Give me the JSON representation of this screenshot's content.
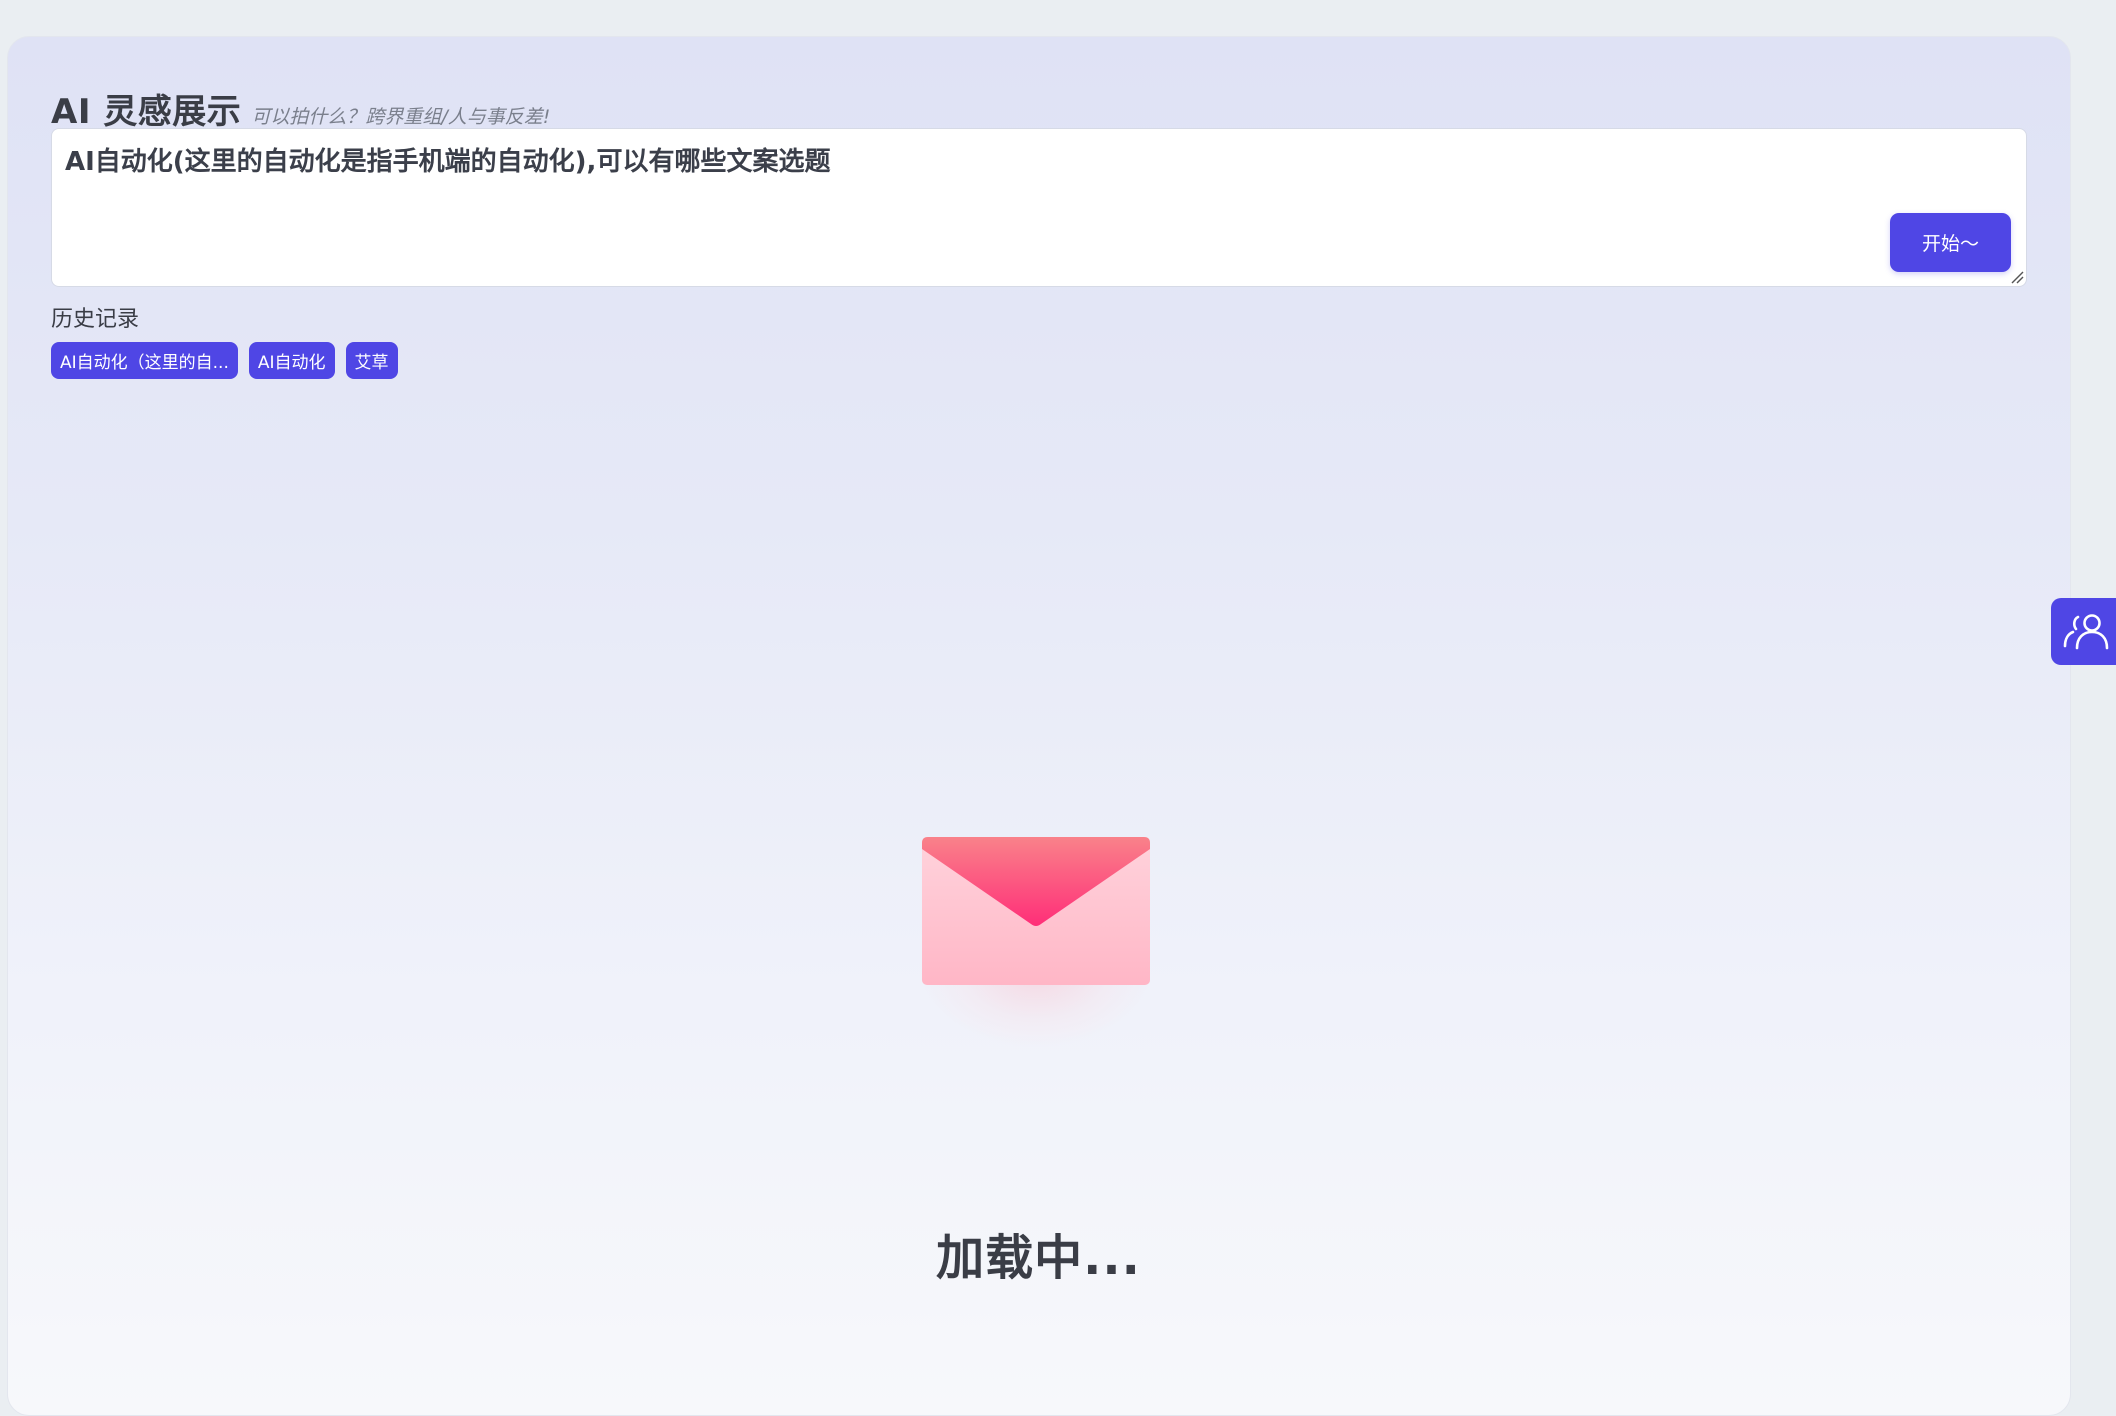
{
  "header": {
    "title": "AI 灵感展示",
    "subtitle": "可以拍什么？跨界重组/人与事反差!"
  },
  "editor": {
    "value": "AI自动化(这里的自动化是指手机端的自动化),可以有哪些文案选题"
  },
  "start_button": {
    "label": "开始～"
  },
  "history": {
    "label": "历史记录",
    "items": [
      {
        "label": "AI自动化（这里的自..."
      },
      {
        "label": "AI自动化"
      },
      {
        "label": "艾草"
      }
    ]
  },
  "side_tab": {
    "icon": "users-icon"
  },
  "loading": {
    "icon": "envelope-icon",
    "text": "加载中..."
  },
  "colors": {
    "accent": "#4f46e5",
    "envelope_top": "#f9828a",
    "envelope_flap": "#ff3d7f",
    "envelope_body": "#ffc3cf"
  }
}
